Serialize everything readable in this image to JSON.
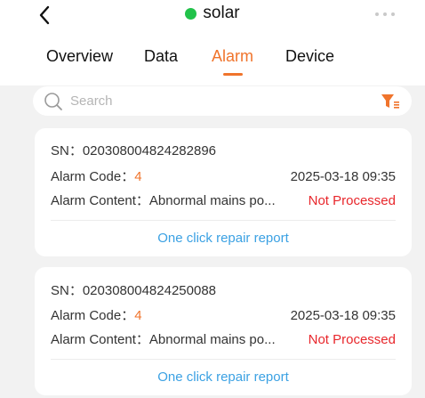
{
  "header": {
    "back_icon": "chevron-left-icon",
    "title": "solar",
    "status_color": "#21c24a",
    "more_icon": "more-dots-icon"
  },
  "tabs": [
    {
      "label": "Overview",
      "active": false
    },
    {
      "label": "Data",
      "active": false
    },
    {
      "label": "Alarm",
      "active": true
    },
    {
      "label": "Device",
      "active": false
    }
  ],
  "search": {
    "placeholder": "Search",
    "value": "",
    "filter_icon": "filter-icon"
  },
  "colors": {
    "accent": "#f0742c",
    "status_unprocessed": "#e8262b",
    "link": "#3ba1e3"
  },
  "alarms": [
    {
      "sn_label": "SN：",
      "sn": "020308004824282896",
      "code_label": "Alarm Code：",
      "code": "4",
      "time": "2025-03-18 09:35",
      "content_label": "Alarm Content：",
      "content": "Abnormal mains po...",
      "status": "Not Processed",
      "action": "One click repair report"
    },
    {
      "sn_label": "SN：",
      "sn": "020308004824250088",
      "code_label": "Alarm Code：",
      "code": "4",
      "time": "2025-03-18 09:35",
      "content_label": "Alarm Content：",
      "content": "Abnormal mains po...",
      "status": "Not Processed",
      "action": "One click repair report"
    }
  ]
}
